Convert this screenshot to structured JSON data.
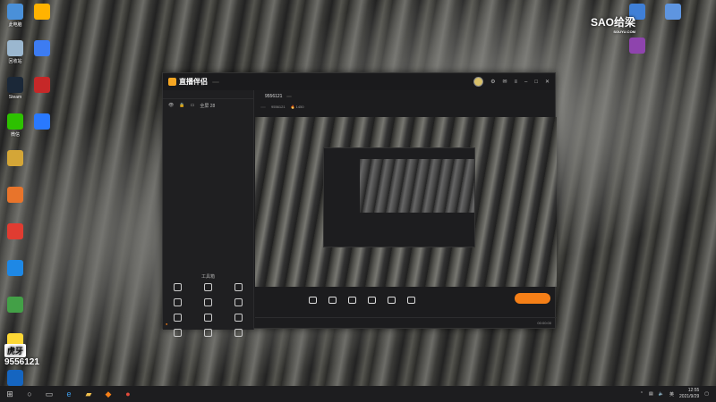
{
  "desktop": {
    "icons_left": [
      {
        "label": "此电脑",
        "color": "#4a90d9"
      },
      {
        "label": "回收站",
        "color": "#9bb7cf"
      },
      {
        "label": "Steam",
        "color": "#1b2838"
      },
      {
        "label": "微信",
        "color": "#2dc100"
      },
      {
        "label": "",
        "color": "#d4a637"
      },
      {
        "label": "",
        "color": "#e8742b"
      },
      {
        "label": "",
        "color": "#e03c31"
      },
      {
        "label": "",
        "color": "#1e88e5"
      },
      {
        "label": "",
        "color": "#43a047"
      },
      {
        "label": "",
        "color": "#fdd835"
      },
      {
        "label": "",
        "color": "#1565c0"
      },
      {
        "label": "",
        "color": "#ffb300"
      },
      {
        "label": "",
        "color": "#3d7cf2"
      },
      {
        "label": "",
        "color": "#c62828"
      },
      {
        "label": "",
        "color": "#2979ff"
      }
    ],
    "icons_right": [
      {
        "label": "",
        "color": "#3f7fd6"
      },
      {
        "label": "",
        "color": "#8e44ad"
      },
      {
        "label": "",
        "color": "#5e95e0"
      }
    ]
  },
  "watermark": {
    "top_right": "SAO给梁",
    "top_right_sub": "SOUYU.COM",
    "bottom_left_brand": "虎牙",
    "room_id": "9556121"
  },
  "app": {
    "name": "直播伴侣",
    "version_badge": "",
    "tabs": [
      "",
      "",
      ""
    ],
    "scene_item": "全屏 28",
    "room_title": "",
    "room_id": "9556121",
    "edit_label": "",
    "category": "",
    "hot_count": "1450",
    "tools_title": "工具箱",
    "tools": [
      "",
      "",
      "",
      "",
      "",
      "",
      "",
      "",
      "",
      "",
      "",
      ""
    ],
    "notice": "",
    "controls": [
      "",
      "",
      "",
      "",
      "",
      ""
    ],
    "start_label": "",
    "status": [
      "",
      "",
      "",
      "00:00:00"
    ]
  },
  "taskbar": {
    "time": "12:55",
    "date": "2021/9/29"
  }
}
